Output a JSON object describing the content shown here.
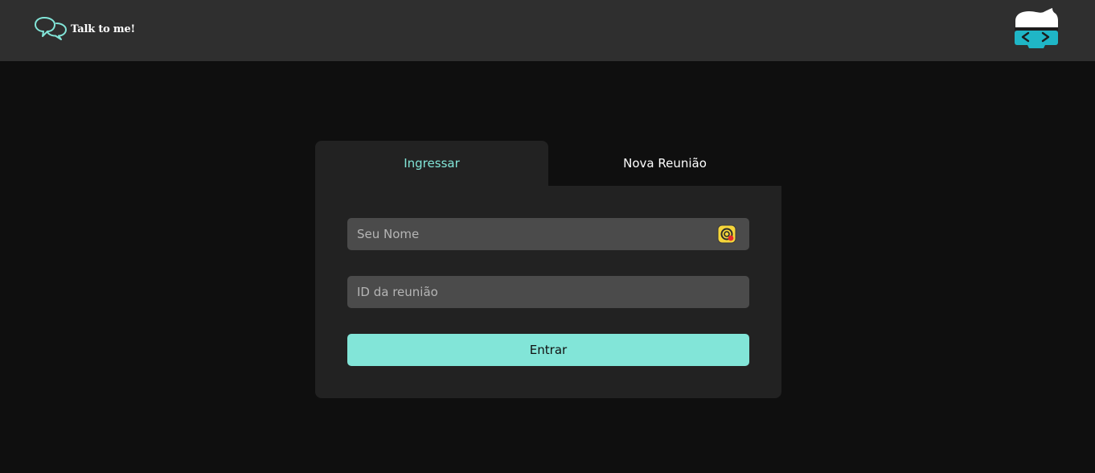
{
  "header": {
    "brand_name": "Talk to me!",
    "brand_icon": "chat-bubbles-icon",
    "avatar_icon": "developer-avatar-icon"
  },
  "tabs": [
    {
      "label": "Ingressar",
      "active": true
    },
    {
      "label": "Nova Reunião",
      "active": false
    }
  ],
  "form": {
    "name_placeholder": "Seu Nome",
    "name_value": "",
    "id_placeholder": "ID da reunião",
    "id_value": "",
    "submit_label": "Entrar",
    "extension_icon": "password-manager-extension-icon"
  },
  "colors": {
    "accent": "#82e5d8",
    "header_bg": "#2f2f2f",
    "page_bg": "#0f0f0f",
    "card_bg": "#222222",
    "input_bg": "#4b4b4b"
  }
}
